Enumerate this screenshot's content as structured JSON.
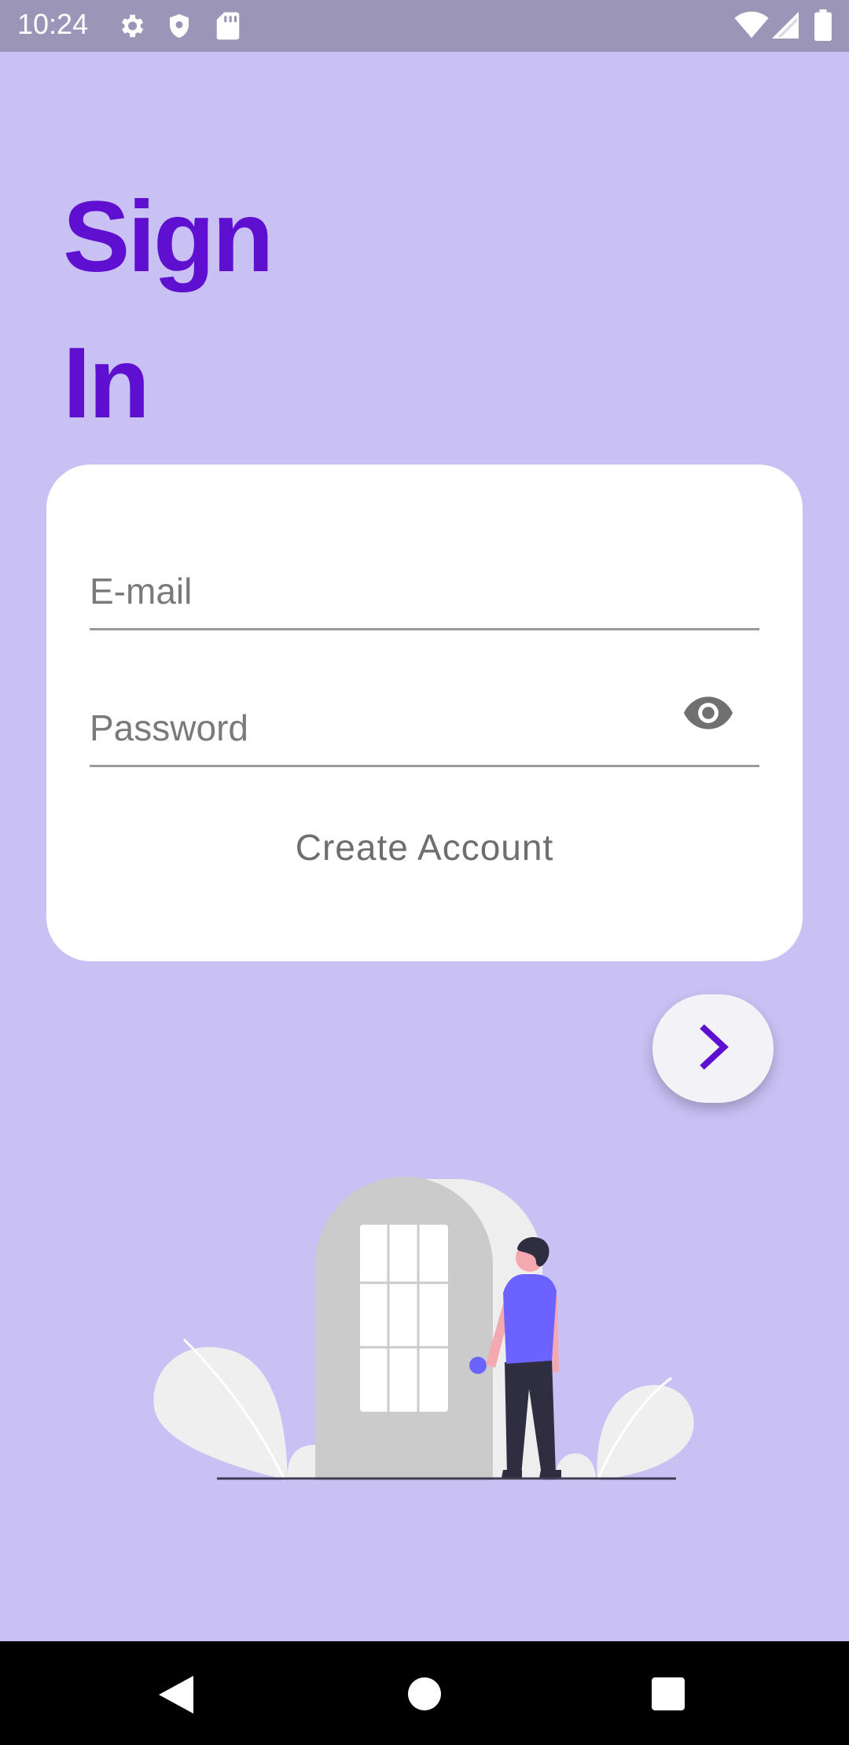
{
  "status_bar": {
    "time": "10:24",
    "icons": [
      "gear-icon",
      "shield-icon",
      "sd-card-icon",
      "wifi-icon",
      "signal-icon",
      "battery-icon"
    ]
  },
  "title": {
    "line1": "Sign",
    "line2": "In"
  },
  "form": {
    "email_placeholder": "E-mail",
    "email_value": "",
    "password_placeholder": "Password",
    "password_value": "",
    "password_toggle_icon": "eye-icon",
    "create_account_label": "Create Account"
  },
  "fab": {
    "icon": "chevron-right-icon"
  },
  "nav_bar": {
    "icons": [
      "back-icon",
      "home-icon",
      "recents-icon"
    ]
  },
  "colors": {
    "background": "#c9c0f3",
    "accent": "#5f0fcf",
    "card": "#ffffff",
    "status_bar": "#9b95b8"
  }
}
